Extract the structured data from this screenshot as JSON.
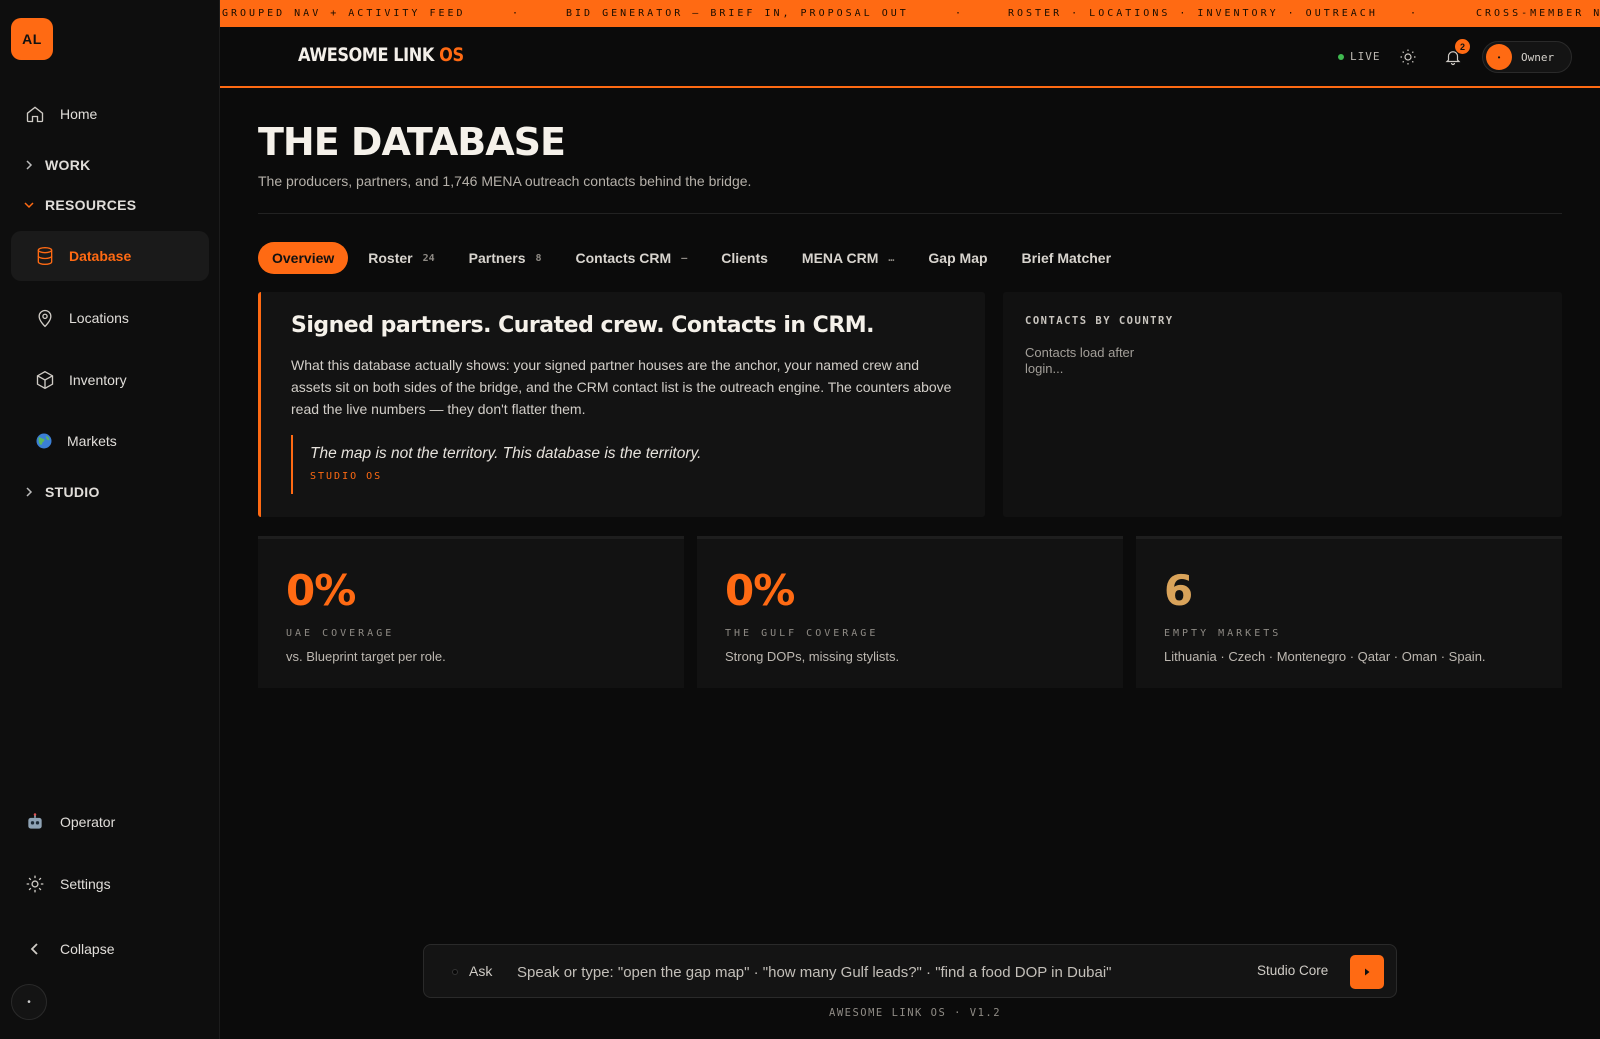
{
  "sidebar": {
    "logo": "AL",
    "home": "Home",
    "work": "WORK",
    "resources": "RESOURCES",
    "items": [
      {
        "label": "Database"
      },
      {
        "label": "Locations"
      },
      {
        "label": "Inventory"
      },
      {
        "label": "Markets"
      }
    ],
    "studio": "STUDIO",
    "operator": "Operator",
    "settings": "Settings",
    "collapse": "Collapse"
  },
  "ticker": [
    "GROUPED NAV + ACTIVITY FEED",
    "·",
    "BID GENERATOR — BRIEF IN, PROPOSAL OUT",
    "·",
    "ROSTER · LOCATIONS · INVENTORY · OUTREACH",
    "·",
    "CROSS-MEMBER N"
  ],
  "header": {
    "brand_main": "AWESOME LINK ",
    "brand_accent": "OS",
    "live": "LIVE",
    "notifications": "2",
    "user": "Owner"
  },
  "page": {
    "title": "THE DATABASE",
    "subtitle": "The producers, partners, and 1,746 MENA outreach contacts behind the bridge."
  },
  "tabs": [
    {
      "label": "Overview",
      "count": ""
    },
    {
      "label": "Roster",
      "count": "24"
    },
    {
      "label": "Partners",
      "count": "8"
    },
    {
      "label": "Contacts CRM",
      "count": "—"
    },
    {
      "label": "Clients",
      "count": ""
    },
    {
      "label": "MENA CRM",
      "count": "…"
    },
    {
      "label": "Gap Map",
      "count": ""
    },
    {
      "label": "Brief Matcher",
      "count": ""
    }
  ],
  "hero": {
    "heading": "Signed partners. Curated crew. Contacts in CRM.",
    "body": "What this database actually shows: your signed partner houses are the anchor, your named crew and assets sit on both sides of the bridge, and the CRM contact list is the outreach engine. The counters above read the live numbers — they don't flatter them.",
    "quote": "The map is not the territory. This database is the territory.",
    "quote_source": "STUDIO OS"
  },
  "contacts_by_country": {
    "heading": "CONTACTS BY COUNTRY",
    "message": "Contacts load after login..."
  },
  "stats": [
    {
      "value": "0%",
      "label": "UAE COVERAGE",
      "description": "vs. Blueprint target per role."
    },
    {
      "value": "0%",
      "label": "THE GULF COVERAGE",
      "description": "Strong DOPs, missing stylists."
    },
    {
      "value": "6",
      "label": "EMPTY MARKETS",
      "description": "Lithuania · Czech · Montenegro · Qatar · Oman · Spain."
    }
  ],
  "ask": {
    "label": "Ask",
    "placeholder": "Speak or type: \"open the gap map\" · \"how many Gulf leads?\" · \"find a food DOP in Dubai\"",
    "model": "Studio Core"
  },
  "footer": {
    "version": "AWESOME LINK OS · V1.2"
  },
  "colors": {
    "accent": "#ff6a13",
    "gold": "#d9a35a",
    "background": "#0b0b0b",
    "live": "#3fb950"
  }
}
